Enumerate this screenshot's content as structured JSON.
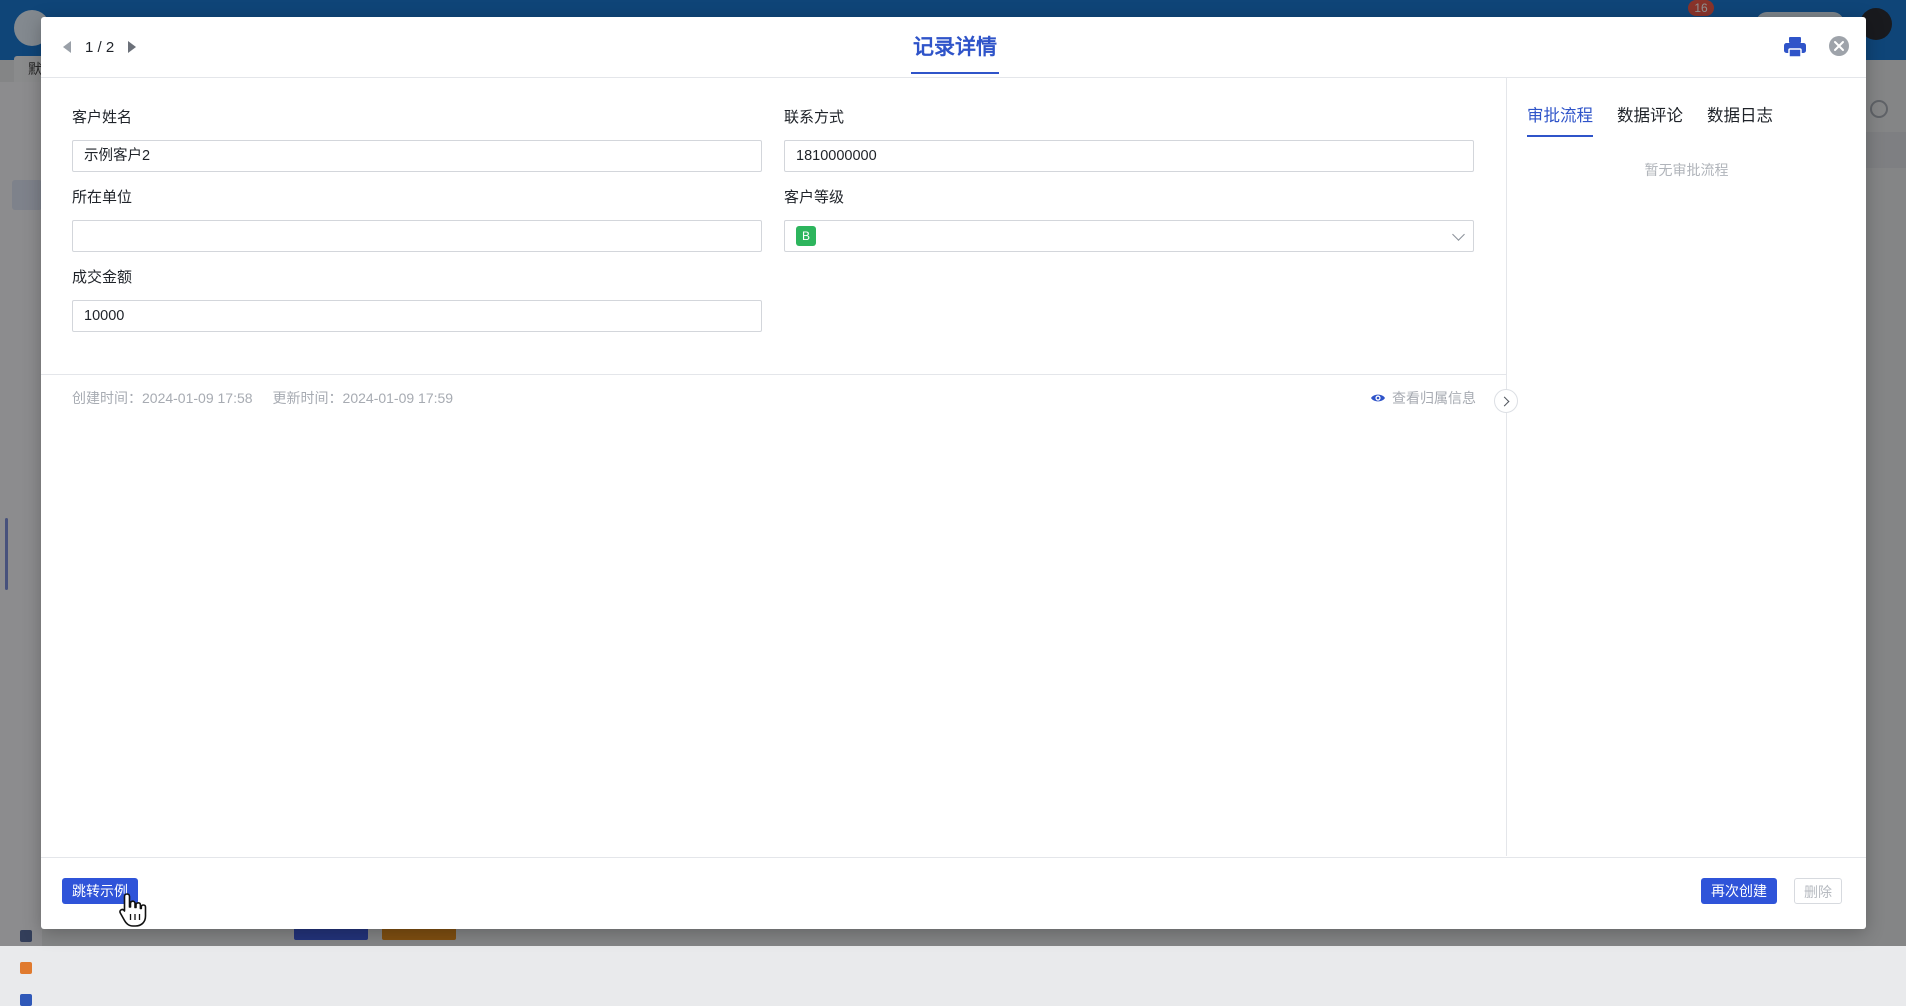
{
  "background": {
    "notification_count": "16",
    "tab_label": "默"
  },
  "modal": {
    "title": "记录详情",
    "pager": {
      "text": "1 / 2"
    },
    "form": {
      "customer_name": {
        "label": "客户姓名",
        "value": "示例客户2"
      },
      "contact": {
        "label": "联系方式",
        "value": "1810000000"
      },
      "company": {
        "label": "所在单位",
        "value": ""
      },
      "level": {
        "label": "客户等级",
        "value": "B",
        "tag_color": "#2db55d"
      },
      "amount": {
        "label": "成交金额",
        "value": "10000"
      }
    },
    "meta": {
      "created": "创建时间：2024-01-09 17:58",
      "updated": "更新时间：2024-01-09 17:59",
      "owner_link": "查看归属信息"
    },
    "side_panel": {
      "tabs": [
        {
          "label": "审批流程",
          "active": true
        },
        {
          "label": "数据评论",
          "active": false
        },
        {
          "label": "数据日志",
          "active": false
        }
      ],
      "empty_text": "暂无审批流程"
    },
    "footer": {
      "jump_label": "跳转示例",
      "recreate_label": "再次创建",
      "delete_label": "删除"
    }
  },
  "colors": {
    "accent": "#2f54c9",
    "primary_button": "#2f54d9",
    "topbar": "#1b7ad4"
  },
  "icons": [
    "print-icon",
    "close-icon",
    "eye-icon",
    "chevron-down-icon",
    "chevron-right-icon",
    "prev-arrow-icon",
    "next-arrow-icon",
    "hand-cursor-icon"
  ]
}
